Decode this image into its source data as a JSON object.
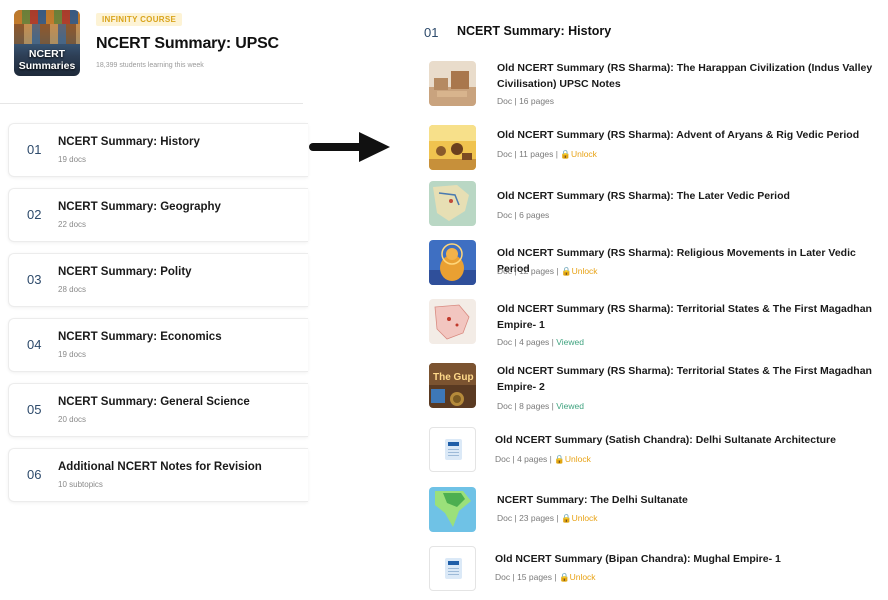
{
  "course": {
    "thumb_text_line1": "NCERT",
    "thumb_text_line2": "Summaries",
    "badge": "INFINITY COURSE",
    "title": "NCERT Summary: UPSC",
    "subtitle": "18,399 students learning this week"
  },
  "chapters": [
    {
      "num": "01",
      "name": "NCERT Summary: History",
      "count": "19 docs"
    },
    {
      "num": "02",
      "name": "NCERT Summary: Geography",
      "count": "22 docs"
    },
    {
      "num": "03",
      "name": "NCERT Summary: Polity",
      "count": "28 docs"
    },
    {
      "num": "04",
      "name": "NCERT Summary: Economics",
      "count": "19 docs"
    },
    {
      "num": "05",
      "name": "NCERT Summary: General Science",
      "count": "20 docs"
    },
    {
      "num": "06",
      "name": "Additional NCERT Notes for Revision",
      "count": "10 subtopics"
    }
  ],
  "detail": {
    "num": "01",
    "title": "NCERT Summary: History",
    "docs": [
      {
        "title": "Old NCERT Summary (RS Sharma): The Harappan Civilization (Indus Valley Civilisation) UPSC Notes",
        "type": "Doc",
        "pages": "16 pages",
        "status": "",
        "thumb": "harappa-image"
      },
      {
        "title": "Old NCERT Summary (RS Sharma): Advent of Aryans & Rig Vedic Period",
        "type": "Doc",
        "pages": "11 pages",
        "status": "Unlock",
        "thumb": "aryans-image"
      },
      {
        "title": "Old NCERT Summary (RS Sharma): The Later Vedic Period",
        "type": "Doc",
        "pages": "6 pages",
        "status": "",
        "thumb": "vedic-map-image"
      },
      {
        "title": "Old NCERT Summary (RS Sharma): Religious Movements in Later Vedic Period",
        "type": "Doc",
        "pages": "12 pages",
        "status": "Unlock",
        "thumb": "buddha-image"
      },
      {
        "title": "Old NCERT Summary (RS Sharma): Territorial States & The First Magadhan Empire- 1",
        "type": "Doc",
        "pages": "4 pages",
        "status": "Viewed",
        "thumb": "magadha-map-image"
      },
      {
        "title": "Old NCERT Summary (RS Sharma): Territorial States & The First Magadhan Empire- 2",
        "type": "Doc",
        "pages": "8 pages",
        "status": "Viewed",
        "thumb": "gupta-image"
      },
      {
        "title": "Old NCERT Summary (Satish Chandra): Delhi Sultanate Architecture",
        "type": "Doc",
        "pages": "4 pages",
        "status": "Unlock",
        "thumb": "doc-file-icon"
      },
      {
        "title": "NCERT Summary: The Delhi Sultanate",
        "type": "Doc",
        "pages": "23 pages",
        "status": "Unlock",
        "thumb": "india-map-image"
      },
      {
        "title": "Old NCERT Summary (Bipan Chandra): Mughal Empire- 1",
        "type": "Doc",
        "pages": "15 pages",
        "status": "Unlock",
        "thumb": "doc-file-icon"
      }
    ]
  },
  "colors": {
    "badge_text": "#d9a41c",
    "number_blue": "#2d4a6b",
    "unlock": "#e8a317",
    "viewed": "#3fa37f"
  }
}
